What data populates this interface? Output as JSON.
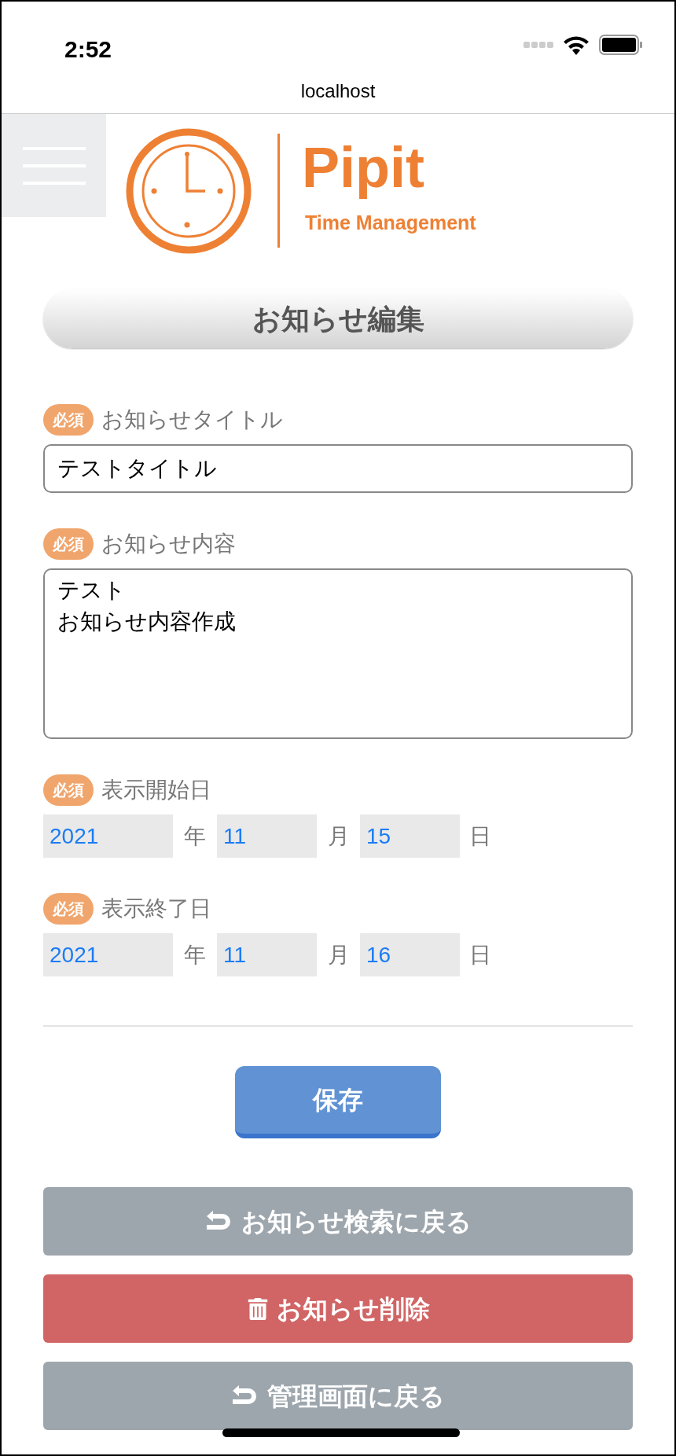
{
  "status_bar": {
    "time": "2:52"
  },
  "browser": {
    "url": "localhost"
  },
  "logo": {
    "name": "Pipit",
    "tagline": "Time Management"
  },
  "page_title": "お知らせ編集",
  "fields": [
    {
      "kind": "text",
      "badge": "必須",
      "label": "お知らせタイトル",
      "value": "テストタイトル"
    },
    {
      "kind": "textarea",
      "badge": "必須",
      "label": "お知らせ内容",
      "lines": [
        "テスト",
        "お知らせ内容作成"
      ]
    },
    {
      "kind": "date",
      "badge": "必須",
      "label": "表示開始日",
      "year": "2021",
      "year_unit": "年",
      "month": "11",
      "month_unit": "月",
      "day": "15",
      "day_unit": "日"
    },
    {
      "kind": "date",
      "badge": "必須",
      "label": "表示終了日",
      "year": "2021",
      "year_unit": "年",
      "month": "11",
      "month_unit": "月",
      "day": "16",
      "day_unit": "日"
    }
  ],
  "save_button": "保存",
  "actions": [
    {
      "kind": "back",
      "label": "お知らせ検索に戻る"
    },
    {
      "kind": "delete",
      "label": "お知らせ削除"
    },
    {
      "kind": "back",
      "label": "管理画面に戻る"
    }
  ]
}
